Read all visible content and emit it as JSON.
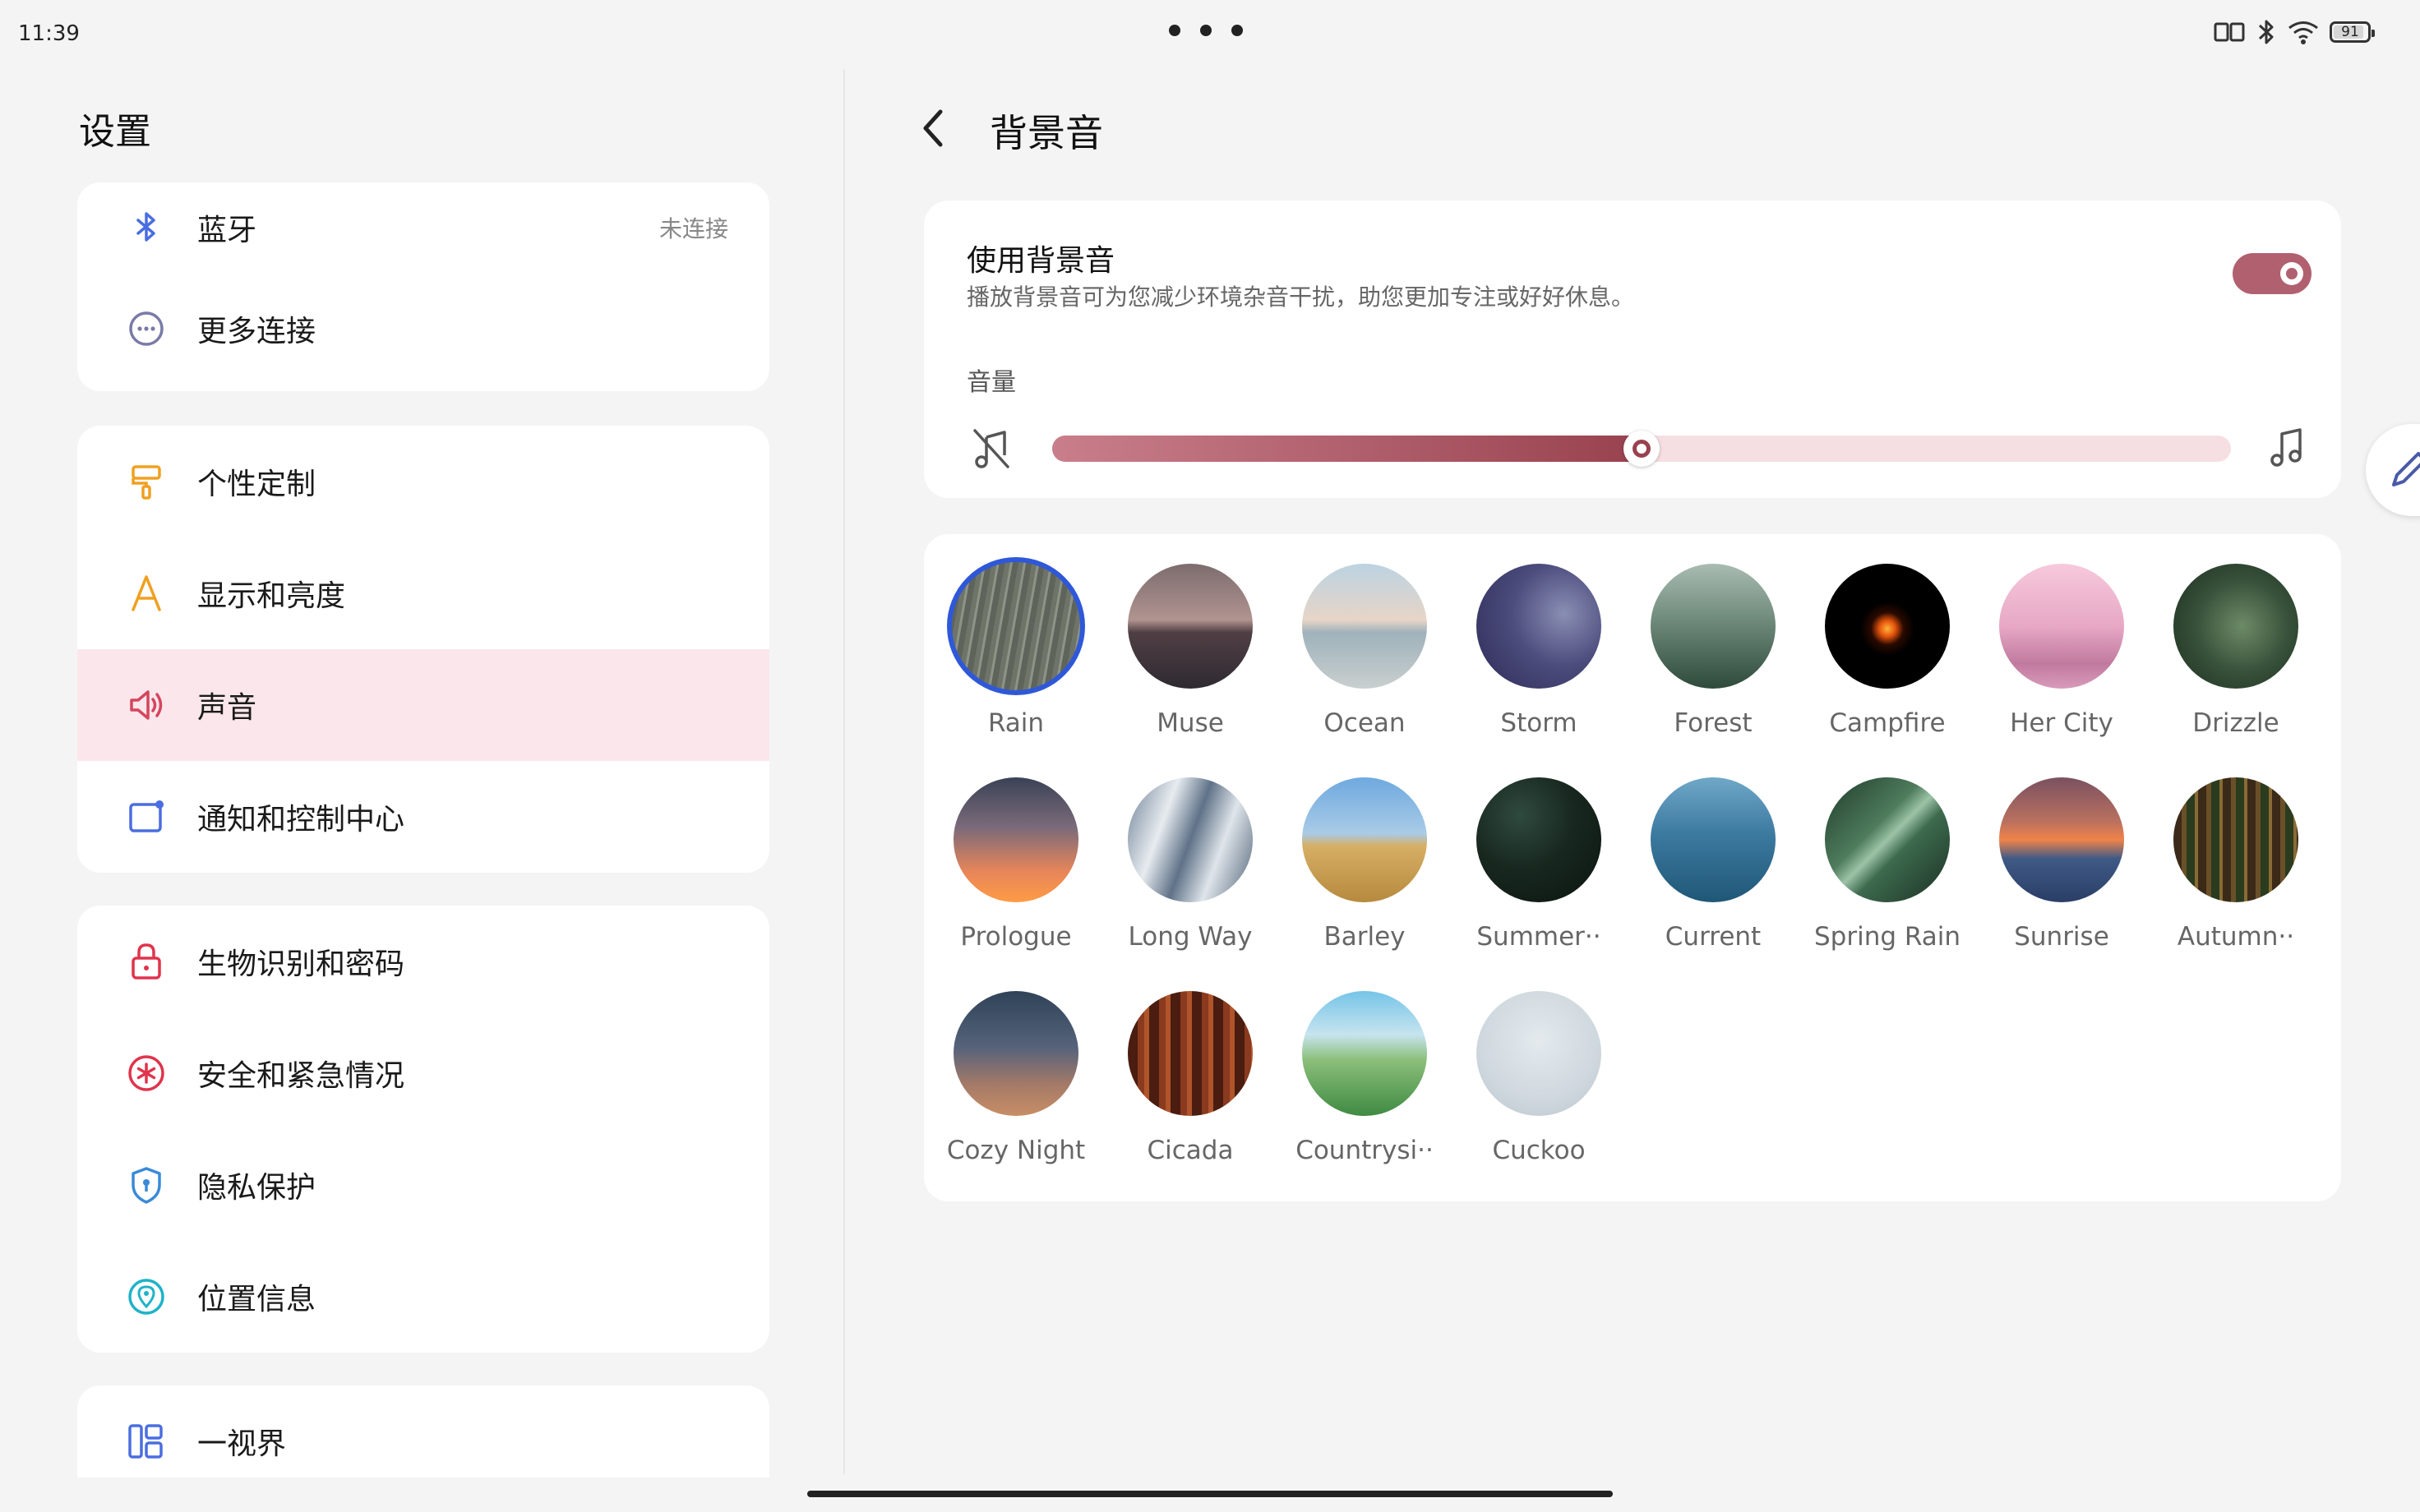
{
  "status_bar": {
    "time": "11:39",
    "battery": "91"
  },
  "left": {
    "title": "设置",
    "groups": [
      {
        "items": [
          {
            "label": "蓝牙",
            "value": "未连接",
            "icon": "bluetooth-icon"
          },
          {
            "label": "更多连接",
            "icon": "more-connections-icon"
          }
        ]
      },
      {
        "items": [
          {
            "label": "个性定制",
            "icon": "paint-roller-icon"
          },
          {
            "label": "显示和亮度",
            "icon": "display-letter-a-icon"
          },
          {
            "label": "声音",
            "icon": "speaker-icon",
            "active": true
          },
          {
            "label": "通知和控制中心",
            "icon": "notification-icon"
          }
        ]
      },
      {
        "items": [
          {
            "label": "生物识别和密码",
            "icon": "lock-icon"
          },
          {
            "label": "安全和紧急情况",
            "icon": "emergency-icon"
          },
          {
            "label": "隐私保护",
            "icon": "shield-icon"
          },
          {
            "label": "位置信息",
            "icon": "location-icon"
          }
        ]
      },
      {
        "items": [
          {
            "label": "一视界",
            "icon": "multi-window-icon"
          }
        ]
      }
    ]
  },
  "right": {
    "title": "背景音",
    "setting": {
      "title": "使用背景音",
      "description": "播放背景音可为您减少环境杂音干扰，助您更加专注或好好休息。",
      "enabled": true
    },
    "volume": {
      "label": "音量",
      "level": 0.5
    },
    "sounds": [
      {
        "name": "Rain",
        "selected": true,
        "bg": "repeating-linear-gradient(100deg,#6f7469 0 6px,#8d9387 6px 9px,#5f645b 9px 16px)"
      },
      {
        "name": "Muse",
        "bg": "linear-gradient(180deg,#7d6c6e 0%,#b09490 45%,#4f3f44 55%,#2f2a31 100%)"
      },
      {
        "name": "Ocean",
        "bg": "linear-gradient(180deg,#bcd3e2 0%,#e7d5c7 45%,#9fb2bb 55%,#c9cfcf 100%)"
      },
      {
        "name": "Storm",
        "bg": "radial-gradient(circle at 70% 40%,#8a8fb4 0%,#4c4c7d 45%,#2c2a55 100%)"
      },
      {
        "name": "Forest",
        "bg": "linear-gradient(180deg,#a9bcb2 0%,#6f8a7b 45%,#2e4a3b 100%)"
      },
      {
        "name": "Campfire",
        "bg": "radial-gradient(circle at 50% 52%,#ffb43a 0%,#e2520c 9%,#2a0a00 18%,#000 30%)"
      },
      {
        "name": "Her City",
        "bg": "linear-gradient(180deg,#f7c9dc 0%,#e7a8c5 50%,#c07a9f 80%,#d99abb 100%)"
      },
      {
        "name": "Drizzle",
        "bg": "radial-gradient(circle at 55% 50%,#6d8a66 0%,#37513a 50%,#1d2e20 100%)"
      },
      {
        "name": "Prologue",
        "bg": "linear-gradient(180deg,#3a4256 0%,#7b6a7a 40%,#e6855a 75%,#ff9b45 100%)"
      },
      {
        "name": "Long Way",
        "bg": "linear-gradient(110deg,#6c7f95 0%,#e8ecf0 30%,#5f7288 50%,#dfe5ea 70%,#4f6176 100%)"
      },
      {
        "name": "Barley",
        "bg": "linear-gradient(180deg,#6ea9df 0%,#a9cbe7 45%,#d6ae64 55%,#b68a3e 100%)"
      },
      {
        "name": "Summer··",
        "bg": "radial-gradient(circle at 35% 30%,#2f4a40 0%,#18281f 45%,#0a1410 100%)"
      },
      {
        "name": "Current",
        "bg": "linear-gradient(180deg,#6fa8c8 0%,#3d7aa0 45%,#1f5776 100%)"
      },
      {
        "name": "Spring Rain",
        "bg": "linear-gradient(135deg,#1f3a2a 0%,#4e7c5c 40%,#9cc3a6 50%,#3d6a4e 60%,#1a2f22 100%)"
      },
      {
        "name": "Sunrise",
        "bg": "linear-gradient(180deg,#7a5160 0%,#b9705f 35%,#f0834a 50%,#3f5a86 65%,#2a3e66 100%)"
      },
      {
        "name": "Autumn··",
        "bg": "repeating-linear-gradient(90deg,#3b2a17 0 10px,#6a5029 10px 16px,#2a3b1e 16px 26px,#8a6a35 26px 30px)"
      },
      {
        "name": "Cozy Night",
        "bg": "linear-gradient(180deg,#2f4357 0%,#55627a 45%,#a47a68 75%,#c88e66 100%)"
      },
      {
        "name": "Cicada",
        "bg": "repeating-linear-gradient(90deg,#4a1d10 0 12px,#8a3a1f 12px 20px,#b0542b 20px 26px)"
      },
      {
        "name": "Countrysi··",
        "bg": "linear-gradient(180deg,#76c4e8 0%,#c6e4ef 35%,#8cbf7a 55%,#3f8a43 100%)"
      },
      {
        "name": "Cuckoo",
        "bg": "radial-gradient(circle at 50% 40%,#e4eaee 0%,#cfd8de 60%,#b9c5cc 100%)"
      }
    ]
  }
}
